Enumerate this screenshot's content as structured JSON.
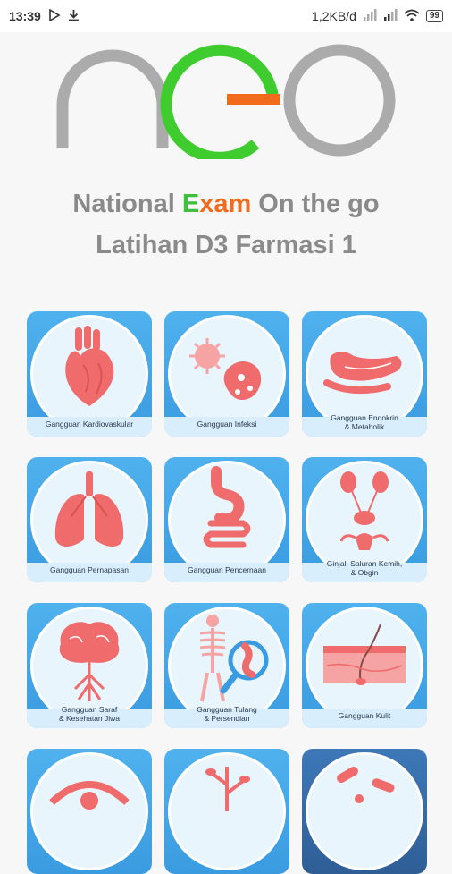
{
  "status_bar": {
    "time": "13:39",
    "net_speed": "1,2KB/d",
    "battery": "99"
  },
  "logo": {
    "text": "neo"
  },
  "title": {
    "part1": "National ",
    "exam_e": "E",
    "exam_rest": "xam",
    "part2": " On the go",
    "subtitle": "Latihan D3 Farmasi 1"
  },
  "colors": {
    "accent_green": "#3fbf3f",
    "accent_orange": "#f26b1d",
    "tile_blue": "#3a9be0",
    "illustration_red": "#f06b6b"
  },
  "categories": [
    {
      "label": "Gangguan Kardiovaskular",
      "icon": "heart-icon"
    },
    {
      "label": "Gangguan Infeksi",
      "icon": "virus-icon"
    },
    {
      "label": "Gangguan Endokrin\n& Metabolik",
      "icon": "pancreas-icon"
    },
    {
      "label": "Gangguan Pernapasan",
      "icon": "lungs-icon"
    },
    {
      "label": "Gangguan Pencernaan",
      "icon": "stomach-icon"
    },
    {
      "label": "Ginjal, Saluran Kemih,\n& Obgin",
      "icon": "kidney-icon"
    },
    {
      "label": "Gangguan Saraf\n& Kesehatan Jiwa",
      "icon": "brain-icon"
    },
    {
      "label": "Gangguan Tulang\n& Persendian",
      "icon": "skeleton-icon"
    },
    {
      "label": "Gangguan Kulit",
      "icon": "skin-icon"
    }
  ]
}
